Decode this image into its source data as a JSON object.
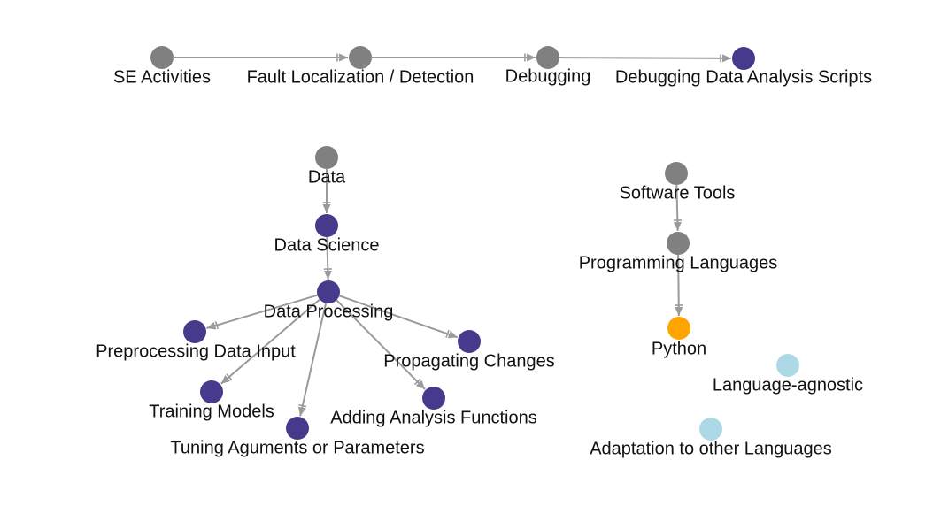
{
  "colors": {
    "edge": "#9a9a9a",
    "root": "#808080",
    "primary": "#463a8c",
    "highlight": "#ffa500",
    "secondary": "#add8e6"
  },
  "nodes": [
    {
      "id": "se",
      "label": "SE Activities",
      "kind": "root"
    },
    {
      "id": "fault",
      "label": "Fault Localization / Detection",
      "kind": "root"
    },
    {
      "id": "debugging",
      "label": "Debugging",
      "kind": "root"
    },
    {
      "id": "debugscripts",
      "label": "Debugging Data Analysis Scripts",
      "kind": "primary"
    },
    {
      "id": "data",
      "label": "Data",
      "kind": "root"
    },
    {
      "id": "datascience",
      "label": "Data Science",
      "kind": "primary"
    },
    {
      "id": "dataprocessing",
      "label": "Data Processing",
      "kind": "primary"
    },
    {
      "id": "preprocessing",
      "label": "Preprocessing Data Input",
      "kind": "primary"
    },
    {
      "id": "training",
      "label": "Training Models",
      "kind": "primary"
    },
    {
      "id": "tuning",
      "label": "Tuning Aguments or Parameters",
      "kind": "primary"
    },
    {
      "id": "adding",
      "label": "Adding Analysis Functions",
      "kind": "primary"
    },
    {
      "id": "propagating",
      "label": "Propagating Changes",
      "kind": "primary"
    },
    {
      "id": "softwaretools",
      "label": "Software Tools",
      "kind": "root"
    },
    {
      "id": "proglang",
      "label": "Programming Languages",
      "kind": "root"
    },
    {
      "id": "python",
      "label": "Python",
      "kind": "highlight"
    },
    {
      "id": "agnostic",
      "label": "Language-agnostic",
      "kind": "secondary"
    },
    {
      "id": "adaptation",
      "label": "Adaptation to other Languages",
      "kind": "secondary"
    }
  ],
  "edges": [
    {
      "from": "se",
      "to": "fault"
    },
    {
      "from": "fault",
      "to": "debugging"
    },
    {
      "from": "debugging",
      "to": "debugscripts"
    },
    {
      "from": "data",
      "to": "datascience"
    },
    {
      "from": "datascience",
      "to": "dataprocessing"
    },
    {
      "from": "dataprocessing",
      "to": "preprocessing"
    },
    {
      "from": "dataprocessing",
      "to": "training"
    },
    {
      "from": "dataprocessing",
      "to": "tuning"
    },
    {
      "from": "dataprocessing",
      "to": "adding"
    },
    {
      "from": "dataprocessing",
      "to": "propagating"
    },
    {
      "from": "softwaretools",
      "to": "proglang"
    },
    {
      "from": "proglang",
      "to": "python"
    }
  ]
}
